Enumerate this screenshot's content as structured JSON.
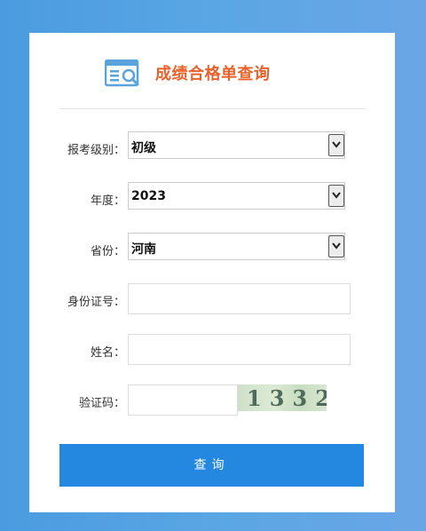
{
  "header": {
    "title": "成绩合格单查询"
  },
  "form": {
    "level": {
      "label": "报考级别：",
      "value": "初级"
    },
    "year": {
      "label": "年度：",
      "value": "2023"
    },
    "province": {
      "label": "省份：",
      "value": "河南"
    },
    "id_number": {
      "label": "身份证号：",
      "value": ""
    },
    "name": {
      "label": "姓名：",
      "value": ""
    },
    "captcha": {
      "label": "验证码：",
      "value": "",
      "image_text": "1332"
    }
  },
  "submit": {
    "label": "查询"
  },
  "colors": {
    "title": "#e9612a",
    "button": "#2487e0",
    "background": "#4a9be0"
  }
}
